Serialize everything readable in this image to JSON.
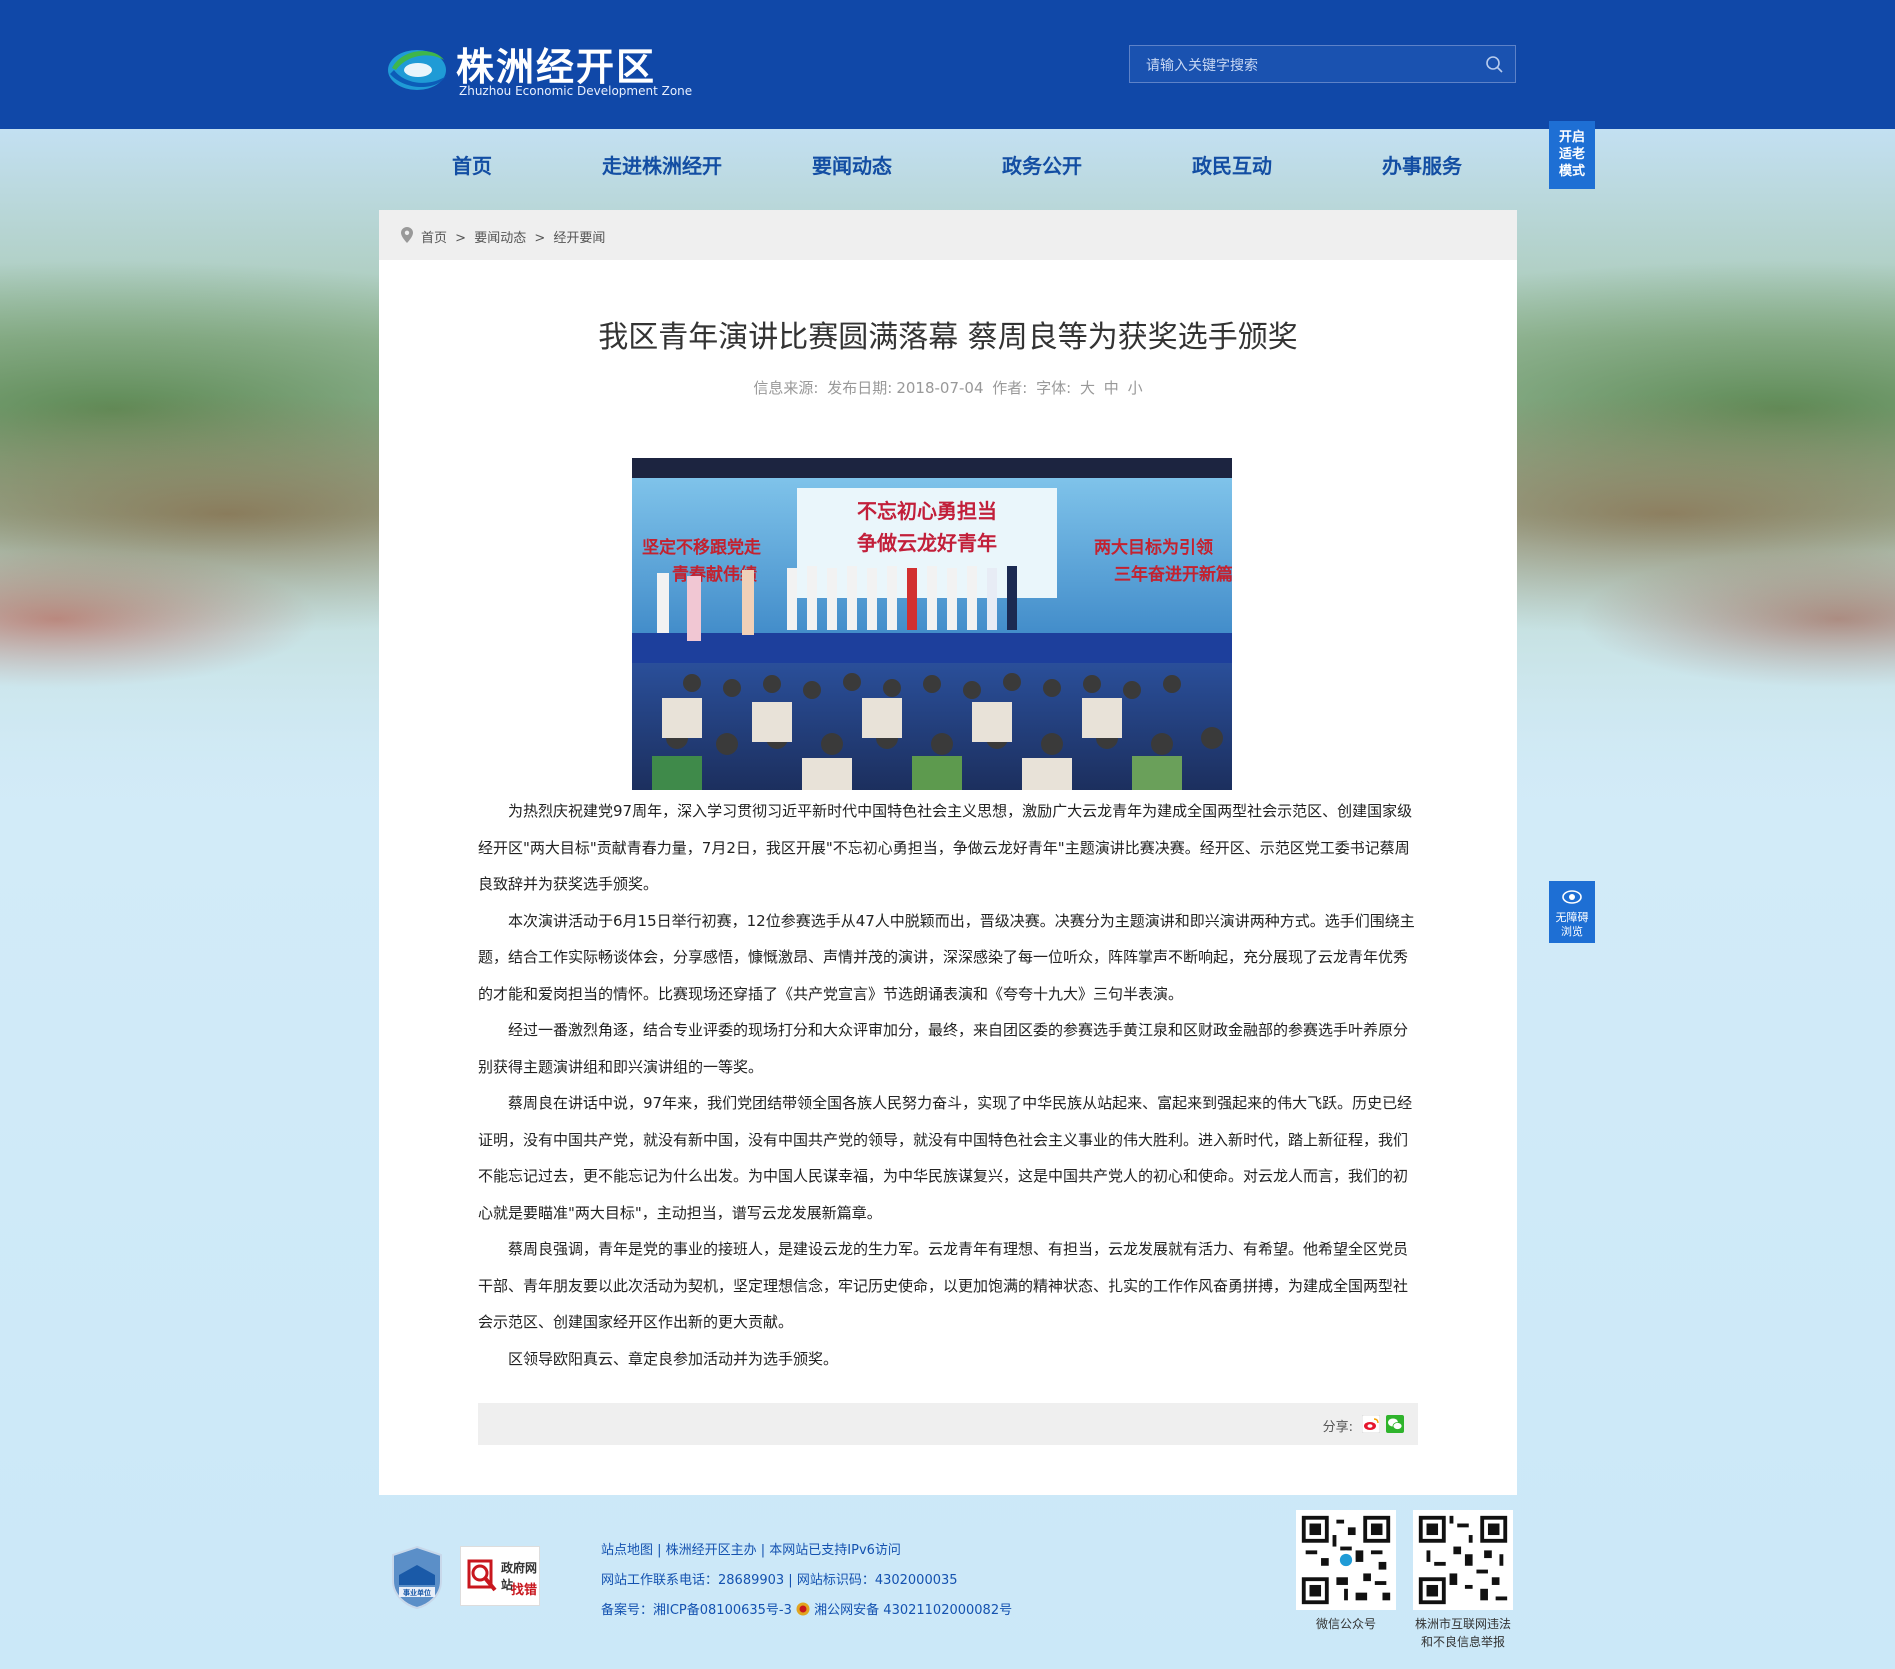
{
  "header": {
    "logo_cn": "株洲经开区",
    "logo_en": "Zhuzhou Economic Development Zone",
    "search_placeholder": "请输入关键字搜索"
  },
  "nav": [
    "首页",
    "走进株洲经开",
    "要闻动态",
    "政务公开",
    "政民互动",
    "办事服务"
  ],
  "side_buttons": {
    "elder_mode": [
      "开启",
      "适老",
      "模式"
    ],
    "accessibility": [
      "无障碍",
      "浏览"
    ]
  },
  "breadcrumb": [
    "首页",
    ">",
    "要闻动态",
    ">",
    "经开要闻"
  ],
  "article": {
    "title": "我区青年演讲比赛圆满落幕 蔡周良等为获奖选手颁奖",
    "meta": {
      "source_label": "信息来源:",
      "date_label": "发布日期:",
      "date": "2018-07-04",
      "author_label": "作者:",
      "font_label": "字体:",
      "font_large": "大",
      "font_medium": "中",
      "font_small": "小"
    },
    "photo_text": {
      "banner_line1": "不忘初心勇担当",
      "banner_line2": "争做云龙好青年",
      "left_line1": "坚定不移跟党走",
      "left_line2": "青春献伟绩",
      "right_line1": "两大目标为引领",
      "right_line2": "三年奋进开新篇"
    },
    "paragraphs": [
      "为热烈庆祝建党97周年，深入学习贯彻习近平新时代中国特色社会主义思想，激励广大云龙青年为建成全国两型社会示范区、创建国家级经开区\"两大目标\"贡献青春力量，7月2日，我区开展\"不忘初心勇担当，争做云龙好青年\"主题演讲比赛决赛。经开区、示范区党工委书记蔡周良致辞并为获奖选手颁奖。",
      "本次演讲活动于6月15日举行初赛，12位参赛选手从47人中脱颖而出，晋级决赛。决赛分为主题演讲和即兴演讲两种方式。选手们围绕主题，结合工作实际畅谈体会，分享感悟，慷慨激昂、声情并茂的演讲，深深感染了每一位听众，阵阵掌声不断响起，充分展现了云龙青年优秀的才能和爱岗担当的情怀。比赛现场还穿插了《共产党宣言》节选朗诵表演和《夸夸十九大》三句半表演。",
      "经过一番激烈角逐，结合专业评委的现场打分和大众评审加分，最终，来自团区委的参赛选手黄江泉和区财政金融部的参赛选手叶养原分别获得主题演讲组和即兴演讲组的一等奖。",
      "蔡周良在讲话中说，97年来，我们党团结带领全国各族人民努力奋斗，实现了中华民族从站起来、富起来到强起来的伟大飞跃。历史已经证明，没有中国共产党，就没有新中国，没有中国共产党的领导，就没有中国特色社会主义事业的伟大胜利。进入新时代，踏上新征程，我们不能忘记过去，更不能忘记为什么出发。为中国人民谋幸福，为中华民族谋复兴，这是中国共产党人的初心和使命。对云龙人而言，我们的初心就是要瞄准\"两大目标\"，主动担当，谱写云龙发展新篇章。",
      "蔡周良强调，青年是党的事业的接班人，是建设云龙的生力军。云龙青年有理想、有担当，云龙发展就有活力、有希望。他希望全区党员干部、青年朋友要以此次活动为契机，坚定理想信念，牢记历史使命，以更加饱满的精神状态、扎实的工作作风奋勇拼搏，为建成全国两型社会示范区、创建国家经开区作出新的更大贡献。",
      "区领导欧阳真云、章定良参加活动并为选手颁奖。"
    ],
    "share_label": "分享:"
  },
  "footer": {
    "badge1_text": "事业单位",
    "badge2_line1": "政府网站",
    "badge2_line2": "找错",
    "line1": "站点地图 | 株洲经开区主办 | 本网站已支持IPv6访问",
    "line2": "网站工作联系电话：28689903 | 网站标识码：4302000035",
    "line3_a": "备案号：湘ICP备08100635号-3",
    "line3_b": "湘公网安备 43021102000082号",
    "qr1_label": "微信公众号",
    "qr2_label_1": "株洲市互联网违法",
    "qr2_label_2": "和不良信息举报"
  },
  "colors": {
    "header_blue": "#1048a8",
    "nav_text": "#134ea3",
    "side_button": "#1e6fd4"
  }
}
